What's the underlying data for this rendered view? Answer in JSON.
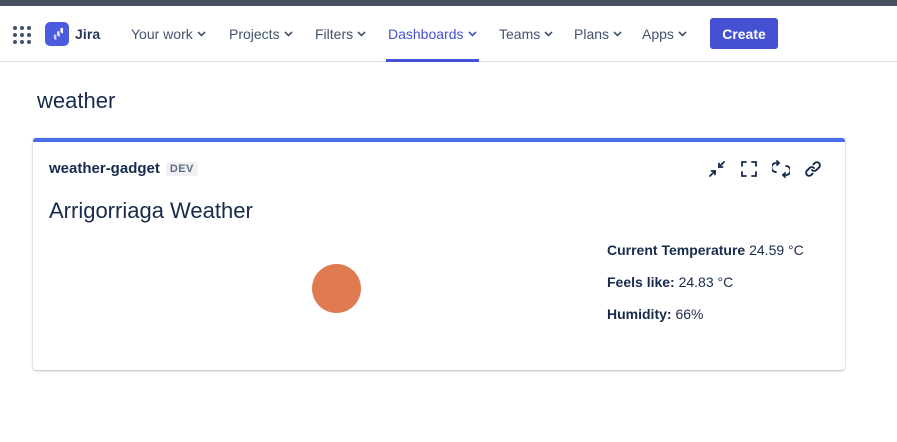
{
  "nav": {
    "brand": "Jira",
    "items": [
      {
        "label": "Your work",
        "active": false
      },
      {
        "label": "Projects",
        "active": false
      },
      {
        "label": "Filters",
        "active": false
      },
      {
        "label": "Dashboards",
        "active": true
      },
      {
        "label": "Teams",
        "active": false
      },
      {
        "label": "Plans",
        "active": false
      },
      {
        "label": "Apps",
        "active": false
      }
    ],
    "create_label": "Create"
  },
  "page": {
    "title": "weather"
  },
  "gadget": {
    "name": "weather-gadget",
    "badge": "DEV",
    "tools": [
      "minimize-icon",
      "fullscreen-icon",
      "refresh-icon",
      "link-icon"
    ],
    "heading": "Arrigorriaga Weather",
    "indicator_color": "#e07a51",
    "stats": {
      "temp_label": "Current Temperature",
      "temp_value": "24.59 °C",
      "feels_label": "Feels like:",
      "feels_value": "24.83 °C",
      "humidity_label": "Humidity:",
      "humidity_value": "66%"
    }
  },
  "colors": {
    "accent": "#4351d2",
    "gadget_border": "#4c6fe8",
    "text": "#172b4d"
  }
}
